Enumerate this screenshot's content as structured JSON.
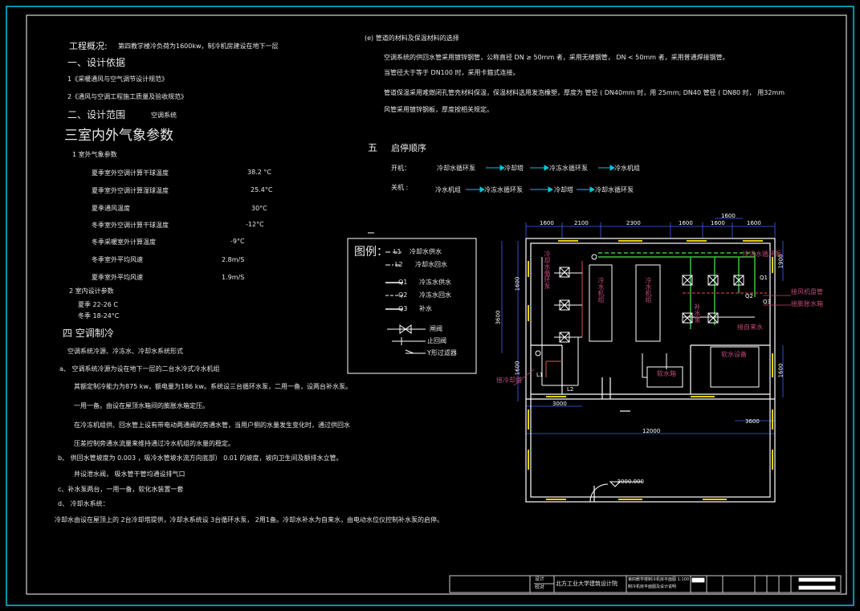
{
  "left": {
    "overview_label": "工程概况:",
    "overview_text": "第四教学楼冷负荷为1600kw，制冷机房建设在地下一层",
    "s1_title": "一、设计依据",
    "s1_item1": "1《采暖通风与空气调节设计规范》",
    "s1_item2": "2《通风与空调工程施工质量及验收规范》",
    "s2_title": "二、设计范围",
    "s2_value": "空调系统",
    "s3_title": "三室内外气象参数",
    "s3_sub1": "1 室外气象参数",
    "params": [
      {
        "label": "夏季室外空调计算干球温度",
        "value": "38.2 °C"
      },
      {
        "label": "夏季室外空调计算湿球温度",
        "value": "25.4°C"
      },
      {
        "label": "夏季通风温度",
        "value": "30°C"
      },
      {
        "label": "冬季室外空调计算干球温度",
        "value": "-12°C"
      },
      {
        "label": "冬季采暖室外计算温度",
        "value": "-9°C"
      },
      {
        "label": "冬季室外平均风速",
        "value": "2.8m/S"
      },
      {
        "label": "夏季室外平均风速",
        "value": "1.9m/S"
      }
    ],
    "s3_sub2": "2 室内设计参数",
    "summer": "夏季 22-26 C",
    "winter": "冬季 18-24°C",
    "s4_title": "四 空调制冷",
    "s4_sub": "空调系统冷源、冷冻水、冷却水系统形式",
    "a_line": "a、 空调系统冷源为设在地下一层的二台水冷式冷水机组",
    "a_line2": "其额定制冷能力为875 kw，额电量为186 kw。系统设三台循环水泵，二用一备，设两台补水泵。",
    "a_line3": "一用一备。由设在屋顶水箱间的膨胀水箱定压。",
    "a_line4": "在冷冻机组供、回水管上设有带电动两通阀的旁通水管，当用户侧的水量发生变化时，通过供回水",
    "a_line5": "压差控制旁通水流量来维持通过冷水机组的水量的稳定。",
    "b_line": "b、 供回水管坡度为 0.003 ，吸冷水管坡水流方向底部） 0.01  的坡度，坡向卫生间及额排水立管。",
    "b_line2": "并设泄水阀，   吸水管干管均通设排气口",
    "c_line": "c、补水泵两台，一用一备，软化水装置一套",
    "d_line": "d、 冷却水系统：",
    "d_line2": "冷却水由设在屋顶上的 2台冷却塔提供，冷却水系统设 3台循环水泵， 2用1备。冷却水补水为自来水，由电动水位仪控制补水泵的启停。"
  },
  "right": {
    "e_title": "(e)   管道的材料及保温材料的选择",
    "e_line1": "空调系统的供回水管采用镀锌钢管，公称直径 DN ≥ 50mm 者，采用无缝钢管， DN < 50mm 者，采用普通焊接钢管。",
    "e_line2": "当管径大于等于 DN100 时，采用卡箍式连接。",
    "e_line3": "管道保温采用难燃闭孔管壳材料保温，保温材料选用发泡橡塑，厚度为  管径 ( DN40mm 时，用 25mm; DN40 管径 ( DN80  时，  用32mm",
    "e_line4": "风管采用镀锌钢板，厚度按相关规定。",
    "s5_num": "五",
    "s5_title": "启停顺序",
    "start_label": "开机：",
    "start_seq": [
      "冷却水循环泵",
      "冷却塔",
      "冷冻水循环泵",
      "冷水机组"
    ],
    "stop_label": "关机 :",
    "stop_seq": [
      "冷水机组",
      "冷冻水循环泵",
      "冷却塔",
      "冷却水循环泵"
    ]
  },
  "legend": {
    "title": "图例：",
    "items": [
      {
        "code": "L1",
        "label": "冷却水供水"
      },
      {
        "code": "L2",
        "label": "冷却水回水"
      },
      {
        "code": "Q1",
        "label": "冷冻水供水"
      },
      {
        "code": "Q2",
        "label": "冷冻水回水"
      },
      {
        "code": "Q3",
        "label": "补水"
      },
      {
        "code": "",
        "label": "闸阀"
      },
      {
        "code": "",
        "label": "止回阀"
      },
      {
        "code": "",
        "label": "Y形过滤器"
      }
    ]
  },
  "plan": {
    "dims_top": [
      "1600",
      "2100",
      "2300",
      "1600",
      "1600",
      "1600"
    ],
    "dims_top2": [
      "1600"
    ],
    "dim_left1": "1600",
    "dim_left2": "3600",
    "dim_left3": "1600",
    "dim_right1": "1900",
    "dim_right2": "1600",
    "dim_bottom1": "3000",
    "dim_bottom2": "3600",
    "dim_total": "12000",
    "level": "-3000.000",
    "labels": {
      "cooling_pump": "冷却水循环泵",
      "chiller1": "冷水机组",
      "chiller2": "冷水机组",
      "chilled_pump": "冷冻水循环泵",
      "make_up_pump": "补水泵",
      "soft_equipment": "软水设备",
      "soft_tank": "软水箱",
      "to_tower": "接冷却塔",
      "to_ahu": "接风机盘管",
      "to_expansion": "接膨胀水箱",
      "tap_water": "接自来水",
      "q1": "Q1",
      "q2": "Q2",
      "q3": "Q3",
      "l1": "L1",
      "l2": "L2"
    }
  },
  "titleblock": {
    "school": "北方工业大学建筑设计院",
    "drawing": "第四教学楼制冷机房平面图 1:100",
    "drawing2": "制冷机房平面图及设计说明",
    "c1": "设计",
    "c2": "校对"
  },
  "colors": {
    "border": "#00c8d8",
    "arrow": "#00c8d8",
    "wall": "#ffffff",
    "window": "#e8d000",
    "pipe_green": "#40c040",
    "pipe_red": "#c04040",
    "dim": "#4060ff",
    "room_label": "#c04878"
  }
}
